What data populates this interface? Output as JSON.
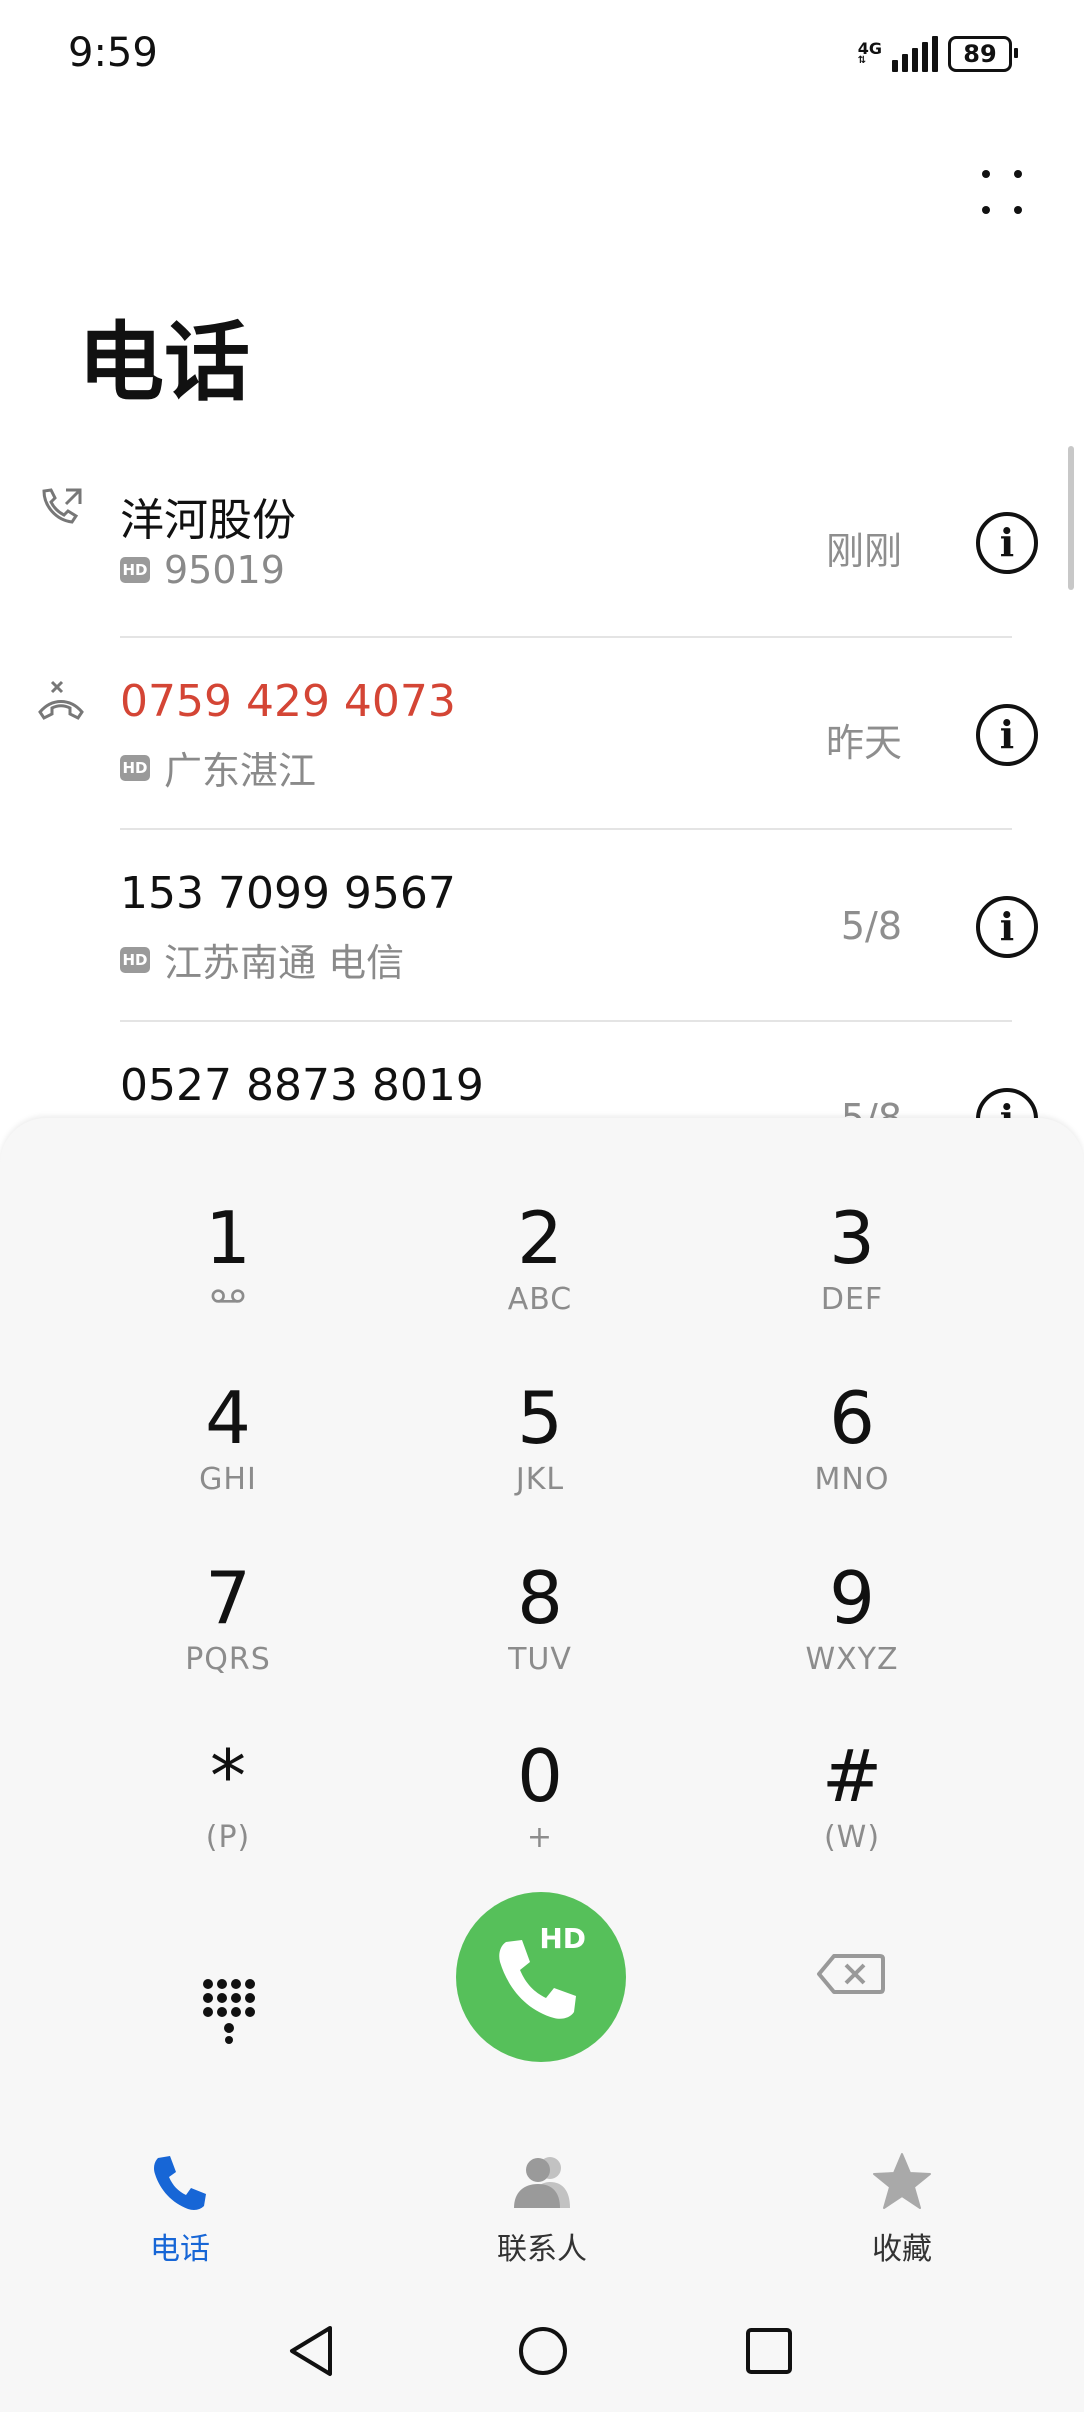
{
  "status_bar": {
    "time": "9:59",
    "network": "4G",
    "battery": "89"
  },
  "header": {
    "title": "电话"
  },
  "call_log": [
    {
      "name": "洋河股份",
      "hd": "HD",
      "detail": "95019",
      "time": "刚刚",
      "type": "outgoing",
      "missed": false
    },
    {
      "name": "0759 429 4073",
      "hd": "HD",
      "detail": "广东湛江",
      "time": "昨天",
      "type": "missed",
      "missed": true
    },
    {
      "name": "153 7099 9567",
      "hd": "HD",
      "detail": "江苏南通 电信",
      "time": "5/8",
      "type": "incoming",
      "missed": false
    },
    {
      "name": "0527 8873 8019",
      "hd": "",
      "detail": "",
      "time": "5/8",
      "type": "incoming",
      "missed": false
    }
  ],
  "info_glyph": "i",
  "dialpad": {
    "keys": [
      {
        "digit": "1",
        "letters": ""
      },
      {
        "digit": "2",
        "letters": "ABC"
      },
      {
        "digit": "3",
        "letters": "DEF"
      },
      {
        "digit": "4",
        "letters": "GHI"
      },
      {
        "digit": "5",
        "letters": "JKL"
      },
      {
        "digit": "6",
        "letters": "MNO"
      },
      {
        "digit": "7",
        "letters": "PQRS"
      },
      {
        "digit": "8",
        "letters": "TUV"
      },
      {
        "digit": "9",
        "letters": "WXYZ"
      },
      {
        "digit": "*",
        "letters": "(P)"
      },
      {
        "digit": "0",
        "letters": "+"
      },
      {
        "digit": "#",
        "letters": "(W)"
      }
    ],
    "call_button_label": "HD",
    "call_color": "#56c05a"
  },
  "bottom_nav": {
    "items": [
      {
        "label": "电话",
        "icon": "phone-icon",
        "active": true
      },
      {
        "label": "联系人",
        "icon": "contacts-icon",
        "active": false
      },
      {
        "label": "收藏",
        "icon": "star-icon",
        "active": false
      }
    ],
    "active_color": "#1766d6"
  },
  "colors": {
    "missed": "#d44535",
    "secondary_text": "#8a8a8a"
  }
}
